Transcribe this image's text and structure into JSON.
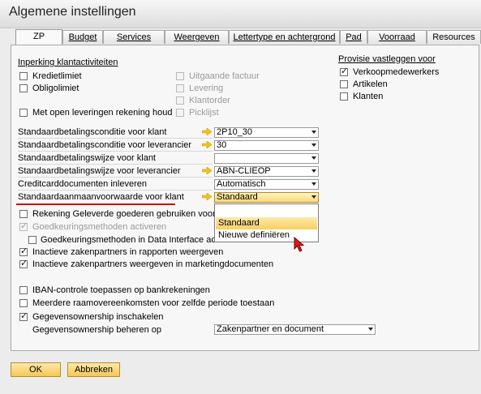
{
  "window": {
    "title": "Algemene instellingen"
  },
  "tabs": [
    {
      "label": "ZP",
      "active": true
    },
    {
      "label": "Budget"
    },
    {
      "label": "Services"
    },
    {
      "label": "Weergeven"
    },
    {
      "label": "Lettertype en achtergrond"
    },
    {
      "label": "Pad"
    },
    {
      "label": "Voorraad"
    },
    {
      "label": "Resources"
    }
  ],
  "restriction": {
    "heading": "Inperking klantactiviteiten",
    "left": [
      {
        "label": "Kredietlimiet",
        "checked": false
      },
      {
        "label": "Obligolimiet",
        "checked": false
      },
      {
        "label": "Met open leveringen rekening houd",
        "checked": false
      }
    ],
    "right": [
      {
        "label": "Uitgaande factuur",
        "checked": false
      },
      {
        "label": "Levering",
        "checked": false
      },
      {
        "label": "Klantorder",
        "checked": false
      },
      {
        "label": "Picklijst",
        "checked": false
      }
    ]
  },
  "commission": {
    "heading": "Provisie vastleggen voor",
    "items": [
      {
        "label": "Verkoopmedewerkers",
        "checked": true
      },
      {
        "label": "Artikelen",
        "checked": false
      },
      {
        "label": "Klanten",
        "checked": false
      }
    ]
  },
  "fields": [
    {
      "label": "Standaardbetalingsconditie voor klant",
      "value": "2P10_30",
      "link": true
    },
    {
      "label": "Standaardbetalingsconditie voor leverancier",
      "value": "30",
      "link": true
    },
    {
      "label": "Standaardbetalingswijze voor klant",
      "value": "",
      "link": false
    },
    {
      "label": "Standaardbetalingswijze voor leverancier",
      "value": "ABN-CLIEOP",
      "link": true
    },
    {
      "label": "Creditcarddocumenten inleveren",
      "value": "Automatisch",
      "link": false
    },
    {
      "label": "Standaardaanmaanvoorwaarde voor klant",
      "value": "Standaard",
      "link": true
    }
  ],
  "dropdown": {
    "options": [
      "",
      "Standaard",
      "Nieuwe definiëren"
    ],
    "highlighted": 1
  },
  "options": [
    {
      "label": "Rekening Geleverde goederen gebruiken voor kla",
      "checked": false,
      "disabled": false
    },
    {
      "label": "Goedkeuringsmethoden activeren",
      "checked": true,
      "disabled": true
    },
    {
      "label": "Goedkeuringsmethoden in Data Interface activeren",
      "checked": false,
      "disabled": false
    },
    {
      "label": "Inactieve zakenpartners in rapporten weergeven",
      "checked": true,
      "disabled": false
    },
    {
      "label": "Inactieve zakenpartners weergeven in marketingdocumenten",
      "checked": true,
      "disabled": false
    },
    {
      "label": "IBAN-controle toepassen op bankrekeningen",
      "checked": false,
      "disabled": false
    },
    {
      "label": "Meerdere raamovereenkomsten voor zelfde periode toestaan",
      "checked": false,
      "disabled": false
    },
    {
      "label": "Gegevensownership inschakelen",
      "checked": true,
      "disabled": false
    }
  ],
  "ownership": {
    "label": "Gegevensownership beheren op",
    "value": "Zakenpartner en document"
  },
  "buttons": {
    "ok": "OK",
    "cancel": "Abbreken"
  },
  "colors": {
    "accent": "#f5c755",
    "link_arrow": "#f0c419",
    "red_underline": "#cc1111"
  }
}
